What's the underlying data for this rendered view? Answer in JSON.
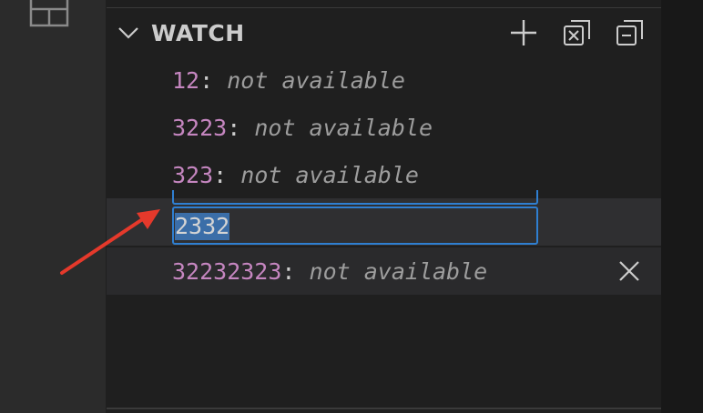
{
  "activity_bar": {
    "icon": "layout-icon"
  },
  "watch": {
    "title": "WATCH",
    "actions": [
      {
        "name": "add-expression-icon"
      },
      {
        "name": "remove-all-expressions-icon"
      },
      {
        "name": "collapse-all-icon"
      }
    ],
    "items": [
      {
        "name": "12",
        "sep": ":",
        "value": "not available"
      },
      {
        "name": "3223",
        "sep": ":",
        "value": "not available"
      },
      {
        "name": "323",
        "sep": ":",
        "value": "not available"
      }
    ],
    "editing": {
      "value": "2332"
    },
    "last_item": {
      "name": "32232323",
      "sep": ":",
      "value": "not available"
    }
  },
  "colors": {
    "accent": "#2f7fd1",
    "expression": "#c586c0",
    "arrow": "#e5392b"
  },
  "annotation": {
    "type": "arrow",
    "color": "#e5392b"
  }
}
